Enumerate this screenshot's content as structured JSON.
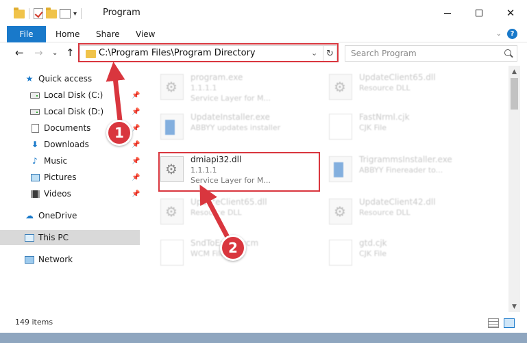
{
  "window": {
    "title": "Program",
    "qat_dropdown": "▾"
  },
  "ribbon": {
    "tabs": [
      "File",
      "Home",
      "Share",
      "View"
    ],
    "collapse_glyph": "⌄",
    "help_glyph": "?"
  },
  "address_bar": {
    "path": "C:\\Program Files\\Program Directory",
    "dropdown_glyph": "⌄",
    "refresh_glyph": "↻",
    "search_placeholder": "Search Program"
  },
  "nav_glyphs": {
    "back": "←",
    "forward": "→",
    "up": "↑",
    "history": "⌄"
  },
  "sidebar": {
    "items": [
      {
        "label": "Quick access",
        "pinned": false
      },
      {
        "label": "Local Disk (C:)",
        "pinned": true
      },
      {
        "label": "Local Disk (D:)",
        "pinned": true
      },
      {
        "label": "Documents",
        "pinned": true
      },
      {
        "label": "Downloads",
        "pinned": true
      },
      {
        "label": "Music",
        "pinned": true
      },
      {
        "label": "Pictures",
        "pinned": true
      },
      {
        "label": "Videos",
        "pinned": true
      },
      {
        "label": "OneDrive",
        "pinned": false
      },
      {
        "label": "This PC",
        "pinned": false
      },
      {
        "label": "Network",
        "pinned": false
      }
    ],
    "pin_glyph": "📌"
  },
  "files": [
    {
      "name": "program.exe",
      "line2": "1.1.1.1",
      "line3": "Service Layer for M...",
      "icon": "dll",
      "blurred": true
    },
    {
      "name": "UpdateClient65.dll",
      "line2": "Resource DLL",
      "line3": "",
      "icon": "dll",
      "blurred": true
    },
    {
      "name": "UpdateInstaller.exe",
      "line2": "ABBYY updates installer",
      "line3": "",
      "icon": "exe",
      "blurred": true
    },
    {
      "name": "FastNrml.cjk",
      "line2": "CJK File",
      "line3": "",
      "icon": "blank",
      "blurred": true
    },
    {
      "name": "dmiapi32.dll",
      "line2": "1.1.1.1",
      "line3": "Service Layer for M...",
      "icon": "dll",
      "blurred": false
    },
    {
      "name": "TrigrammsInstaller.exe",
      "line2": "ABBYY Finereader to...",
      "line3": "",
      "icon": "exe",
      "blurred": true
    },
    {
      "name": "UpdateClient65.dll",
      "line2": "Resource DLL",
      "line3": "",
      "icon": "dll",
      "blurred": true
    },
    {
      "name": "UpdateClient42.dll",
      "line2": "Resource DLL",
      "line3": "",
      "icon": "dll",
      "blurred": true
    },
    {
      "name": "SndToExcel.wcm",
      "line2": "WCM File",
      "line3": "",
      "icon": "blank",
      "blurred": true
    },
    {
      "name": "gtd.cjk",
      "line2": "CJK File",
      "line3": "",
      "icon": "blank",
      "blurred": true
    }
  ],
  "scrollbar": {
    "up_glyph": "▲",
    "down_glyph": "▼"
  },
  "status": {
    "item_count": "149 items"
  },
  "steps": [
    "1",
    "2"
  ],
  "colors": {
    "accent": "#1979ca",
    "highlight": "#d9363e"
  }
}
